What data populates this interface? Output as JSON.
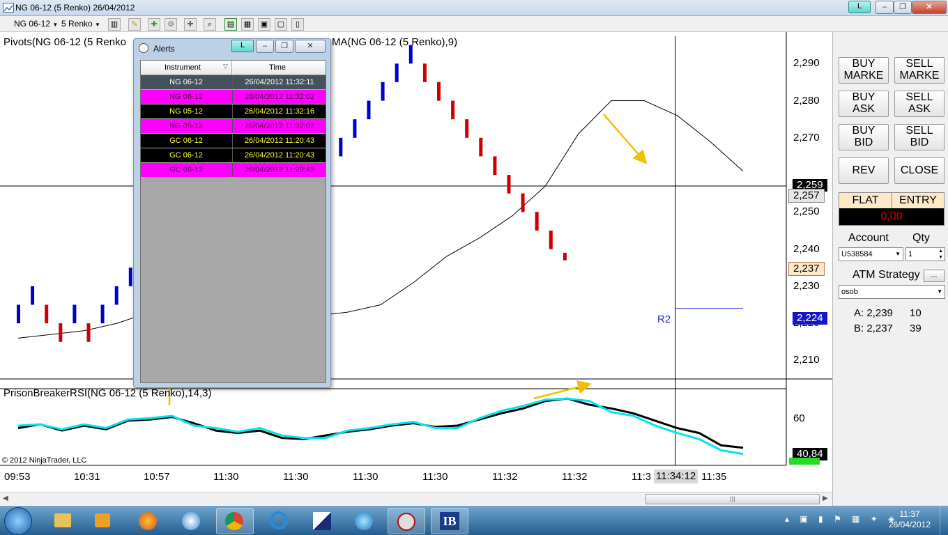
{
  "window": {
    "title": "NG 06-12 (5 Renko)  26/04/2012",
    "l_button": "L"
  },
  "toolbar": {
    "instrument": "NG 06-12",
    "period": "5 Renko"
  },
  "chart": {
    "price_title": "Pivots(NG 06-12 (5 Renko",
    "price_title_right": "MA(NG 06-12 (5 Renko),9)",
    "rsi_title": "PrisonBreakerRSI(NG 06-12 (5 Renko),14,3)",
    "copyright": "© 2012 NinjaTrader, LLC",
    "r2_label": "R2",
    "y_ticks": [
      "2,290",
      "2,280",
      "2,270",
      "2,259",
      "2,250",
      "2,240",
      "2,230",
      "2,220",
      "2,210"
    ],
    "rsi_ticks": [
      "60"
    ],
    "x_ticks": [
      "09:53",
      "10:31",
      "10:57",
      "11:30",
      "11:30",
      "11:30",
      "11:30",
      "11:32",
      "11:32",
      "11:3",
      "11:35"
    ],
    "crosshair_time": "11:34:12",
    "last_price_tag": "2,259",
    "crosshair_price_tag": "2,257",
    "ask_price_tag": "2,237",
    "r2_price_tag": "2,224",
    "rsi_value_tag": "40,84",
    "colors": {
      "up": "#0000cc",
      "down": "#cc0000",
      "ma": "#000000",
      "rsi_main": "#000000",
      "rsi_signal": "#00e5ee",
      "arrow": "#f0c000"
    }
  },
  "chart_data": {
    "type": "line",
    "title": "Pivots(NG 06-12 (5 Renko",
    "ylim": [
      2205,
      2297
    ],
    "renko_bricks": [
      {
        "dir": "up",
        "low": 2220,
        "high": 2225
      },
      {
        "dir": "up",
        "low": 2225,
        "high": 2230
      },
      {
        "dir": "down",
        "low": 2220,
        "high": 2225
      },
      {
        "dir": "down",
        "low": 2215,
        "high": 2220
      },
      {
        "dir": "up",
        "low": 2220,
        "high": 2225
      },
      {
        "dir": "down",
        "low": 2215,
        "high": 2220
      },
      {
        "dir": "up",
        "low": 2220,
        "high": 2225
      },
      {
        "dir": "up",
        "low": 2225,
        "high": 2230
      },
      {
        "dir": "up",
        "low": 2230,
        "high": 2235
      },
      {
        "dir": "down",
        "low": 2215,
        "high": 2220
      },
      {
        "dir": "up",
        "low": 2220,
        "high": 2225
      },
      {
        "dir": "up",
        "low": 2225,
        "high": 2230
      },
      {
        "dir": "up",
        "low": 2230,
        "high": 2235
      },
      {
        "dir": "up",
        "low": 2235,
        "high": 2240
      },
      {
        "dir": "up",
        "low": 2240,
        "high": 2245
      },
      {
        "dir": "up",
        "low": 2245,
        "high": 2250
      },
      {
        "dir": "down",
        "low": 2240,
        "high": 2245
      },
      {
        "dir": "down",
        "low": 2235,
        "high": 2240
      },
      {
        "dir": "up",
        "low": 2240,
        "high": 2245
      },
      {
        "dir": "up",
        "low": 2245,
        "high": 2250
      },
      {
        "dir": "up",
        "low": 2250,
        "high": 2255
      },
      {
        "dir": "up",
        "low": 2255,
        "high": 2260
      },
      {
        "dir": "up",
        "low": 2260,
        "high": 2265
      },
      {
        "dir": "up",
        "low": 2265,
        "high": 2270
      },
      {
        "dir": "up",
        "low": 2270,
        "high": 2275
      },
      {
        "dir": "up",
        "low": 2275,
        "high": 2280
      },
      {
        "dir": "up",
        "low": 2280,
        "high": 2285
      },
      {
        "dir": "up",
        "low": 2285,
        "high": 2290
      },
      {
        "dir": "up",
        "low": 2290,
        "high": 2295
      },
      {
        "dir": "down",
        "low": 2285,
        "high": 2290
      },
      {
        "dir": "down",
        "low": 2280,
        "high": 2285
      },
      {
        "dir": "down",
        "low": 2275,
        "high": 2280
      },
      {
        "dir": "down",
        "low": 2270,
        "high": 2275
      },
      {
        "dir": "down",
        "low": 2265,
        "high": 2270
      },
      {
        "dir": "down",
        "low": 2260,
        "high": 2265
      },
      {
        "dir": "down",
        "low": 2255,
        "high": 2260
      },
      {
        "dir": "down",
        "low": 2250,
        "high": 2255
      },
      {
        "dir": "down",
        "low": 2245,
        "high": 2250
      },
      {
        "dir": "down",
        "low": 2240,
        "high": 2245
      },
      {
        "dir": "down",
        "low": 2237,
        "high": 2239
      }
    ],
    "ma_values": [
      2216,
      2217,
      2218,
      2220,
      2223,
      2226,
      2228,
      2229,
      2223,
      2222,
      2223,
      2225,
      2231,
      2238,
      2243,
      2249,
      2257,
      2271,
      2280,
      2280,
      2276,
      2269,
      2261
    ],
    "rsi": {
      "main": [
        58,
        61,
        56,
        60,
        57,
        64,
        65,
        67,
        62,
        56,
        54,
        56,
        50,
        49,
        52,
        55,
        57,
        60,
        62,
        59,
        60,
        65,
        70,
        74,
        80,
        82,
        77,
        74,
        70,
        64,
        58,
        54,
        44,
        42
      ],
      "signal": [
        60,
        61,
        57,
        61,
        58,
        65,
        66,
        68,
        60,
        58,
        55,
        58,
        52,
        50,
        50,
        56,
        58,
        61,
        63,
        58,
        58,
        66,
        72,
        76,
        81,
        82,
        80,
        71,
        68,
        60,
        54,
        49,
        40,
        37
      ],
      "ylim": [
        30,
        90
      ]
    },
    "r2_level": 2224
  },
  "alerts": {
    "title": "Alerts",
    "l_button": "L",
    "columns": [
      "Instrument",
      "Time"
    ],
    "rows": [
      {
        "instrument": "NG 06-12",
        "time": "26/04/2012 11:32:11",
        "bg": "#45525c",
        "fg": "#ffffff"
      },
      {
        "instrument": "NG 06-12",
        "time": "26/04/2012 11:32:02",
        "bg": "#ff00ff",
        "fg": "#4d004d"
      },
      {
        "instrument": "NG 05-12",
        "time": "26/04/2012 11:32:16",
        "bg": "#000000",
        "fg": "#ffff33"
      },
      {
        "instrument": "NG 05-12",
        "time": "26/04/2012 11:32:02",
        "bg": "#ff00ff",
        "fg": "#4d004d"
      },
      {
        "instrument": "GC 06-12",
        "time": "26/04/2012 11:20:43",
        "bg": "#000000",
        "fg": "#ffff33"
      },
      {
        "instrument": "GC 06-12",
        "time": "26/04/2012 11:20:43",
        "bg": "#000000",
        "fg": "#ffff33"
      },
      {
        "instrument": "GC 06-12",
        "time": "26/04/2012 11:20:43",
        "bg": "#ff00ff",
        "fg": "#4d004d"
      }
    ]
  },
  "panel": {
    "buy_market": "BUY\nMARKE",
    "sell_market": "SELL\nMARKE",
    "buy_ask": "BUY\nASK",
    "sell_ask": "SELL\nASK",
    "buy_bid": "BUY\nBID",
    "sell_bid": "SELL\nBID",
    "rev": "REV",
    "close": "CLOSE",
    "flat": "FLAT",
    "entry": "ENTRY",
    "pnl": "0,00",
    "account_label": "Account",
    "qty_label": "Qty",
    "account_value": "U538584",
    "qty_value": "1",
    "atm_label": "ATM Strategy",
    "atm_button": "...",
    "atm_value": "osob",
    "ask_label": "A: 2,239",
    "ask_size": "10",
    "bid_label": "B: 2,237",
    "bid_size": "39"
  },
  "tray": {
    "time": "11:37",
    "date": "26/04/2012"
  }
}
